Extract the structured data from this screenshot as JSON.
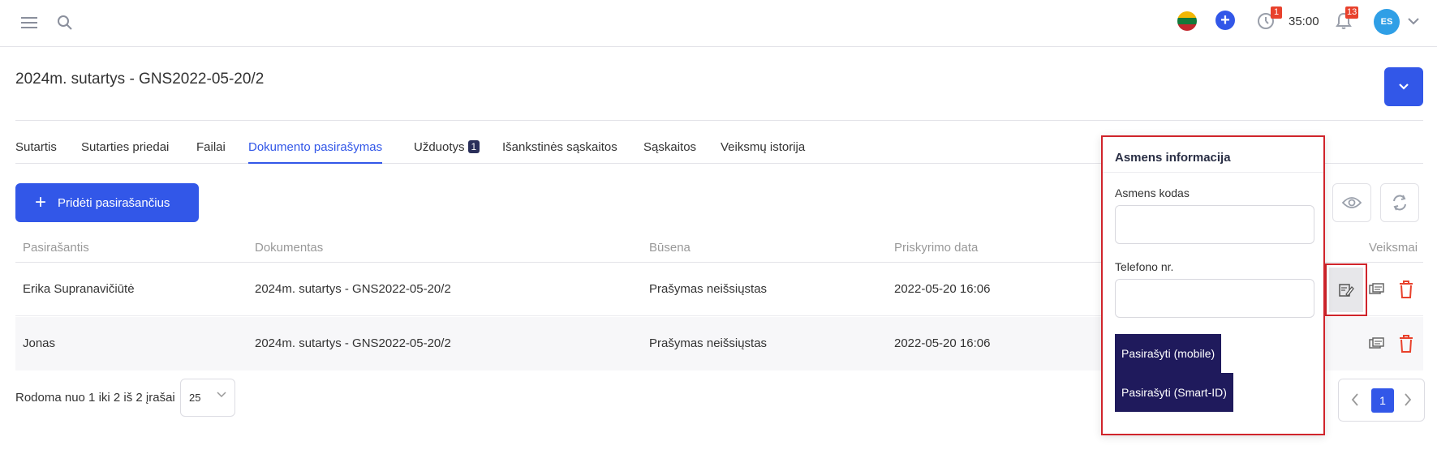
{
  "topbar": {
    "timer": "35:00",
    "clock_badge": "1",
    "notifications_badge": "13",
    "avatar_initials": "ES",
    "icons": [
      "menu-icon",
      "search-icon",
      "flag-lt-icon",
      "plus-circle-icon",
      "clock-icon",
      "bell-icon",
      "chevron-down-icon"
    ]
  },
  "page": {
    "title": "2024m. sutartys - GNS2022-05-20/2"
  },
  "tabs": [
    {
      "label": "Sutartis"
    },
    {
      "label": "Sutarties priedai"
    },
    {
      "label": "Failai"
    },
    {
      "label": "Dokumento pasirašymas",
      "active": true
    },
    {
      "label": "Užduotys",
      "count": "1"
    },
    {
      "label": "Išankstinės sąskaitos"
    },
    {
      "label": "Sąskaitos"
    },
    {
      "label": "Veiksmų istorija"
    }
  ],
  "actions": {
    "add_signer_label": "Pridėti pasirašančius"
  },
  "table": {
    "headers": {
      "signer": "Pasirašantis",
      "document": "Dokumentas",
      "status": "Būsena",
      "assigned_date": "Priskyrimo data",
      "actions": "Veiksmai"
    },
    "rows": [
      {
        "signer": "Erika Supranavičiūtė",
        "document": "2024m. sutartys - GNS2022-05-20/2",
        "status": "Prašymas neišsiųstas",
        "assigned_date": "2022-05-20 16:06"
      },
      {
        "signer": "Jonas",
        "document": "2024m. sutartys - GNS2022-05-20/2",
        "status": "Prašymas neišsiųstas",
        "assigned_date": "2022-05-20 16:06"
      }
    ]
  },
  "footer": {
    "rows_info": "Rodoma nuo 1 iki 2 iš 2 įrašai",
    "page_size": "25",
    "current_page": "1"
  },
  "popover": {
    "title": "Asmens informacija",
    "personal_code_label": "Asmens kodas",
    "personal_code_value": "",
    "phone_label": "Telefono nr.",
    "phone_value": "",
    "sign_mobile_label": "Pasirašyti (mobile)",
    "sign_smartid_label": "Pasirašyti (Smart-ID)"
  },
  "colors": {
    "primary": "#3257e8",
    "dark_button": "#1f1a5c",
    "danger": "#e8412c",
    "highlight_border": "#d0242b"
  }
}
